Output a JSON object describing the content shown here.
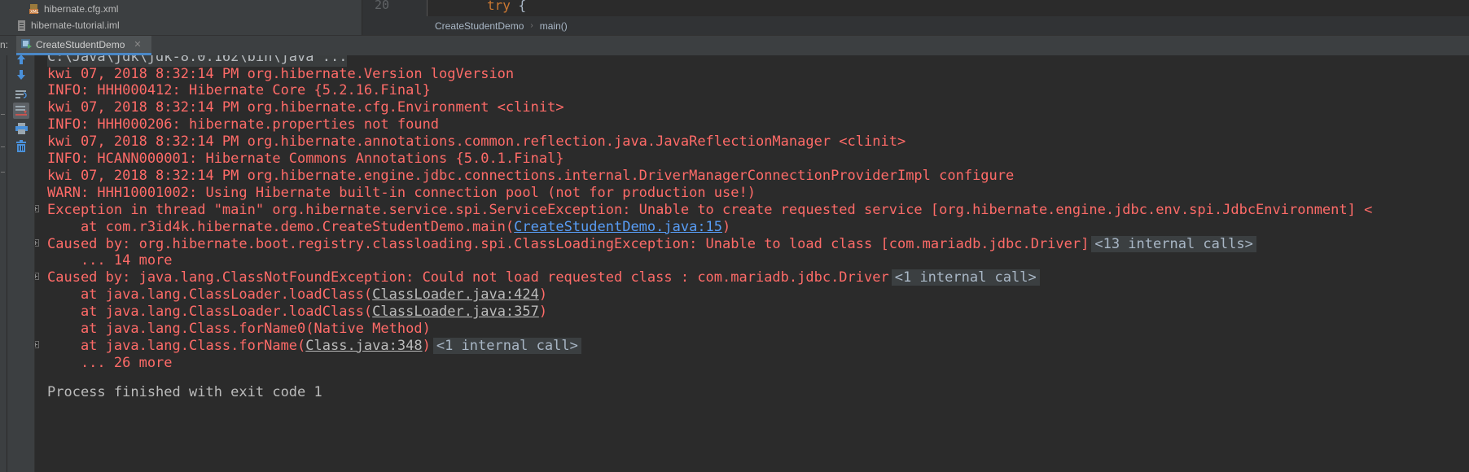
{
  "project": {
    "files": [
      {
        "name": "hibernate.cfg.xml",
        "icon": "xml-file-icon"
      },
      {
        "name": "hibernate-tutorial.iml",
        "icon": "module-file-icon"
      }
    ]
  },
  "editor": {
    "line_number": "20",
    "code_keyword": "try",
    "code_rest": " {",
    "breadcrumb": [
      "CreateStudentDemo",
      "main()"
    ]
  },
  "run_panel": {
    "label": "n:",
    "tab_title": "CreateStudentDemo",
    "toolbar_icons": [
      "up-arrow-icon",
      "down-arrow-icon",
      "soft-wrap-icon",
      "scroll-to-end-icon",
      "print-icon",
      "trash-icon"
    ]
  },
  "console": {
    "command": "C:\\Java\\jdk\\jdk-8.0.162\\bin\\java ...",
    "lines": [
      {
        "text": "kwi 07, 2018 8:32:14 PM org.hibernate.Version logVersion"
      },
      {
        "text": "INFO: HHH000412: Hibernate Core {5.2.16.Final}"
      },
      {
        "text": "kwi 07, 2018 8:32:14 PM org.hibernate.cfg.Environment <clinit>"
      },
      {
        "text": "INFO: HHH000206: hibernate.properties not found"
      },
      {
        "text": "kwi 07, 2018 8:32:14 PM org.hibernate.annotations.common.reflection.java.JavaReflectionManager <clinit>"
      },
      {
        "text": "INFO: HCANN000001: Hibernate Commons Annotations {5.0.1.Final}"
      },
      {
        "text": "kwi 07, 2018 8:32:14 PM org.hibernate.engine.jdbc.connections.internal.DriverManagerConnectionProviderImpl configure"
      },
      {
        "text": "WARN: HHH10001002: Using Hibernate built-in connection pool (not for production use!)"
      },
      {
        "text": "Exception in thread \"main\" org.hibernate.service.spi.ServiceException: Unable to create requested service [org.hibernate.engine.jdbc.env.spi.JdbcEnvironment] <",
        "fold": true
      },
      {
        "text": "    at com.r3id4k.hibernate.demo.CreateStudentDemo.main(",
        "link": "CreateStudentDemo.java:15",
        "after": ")",
        "link_style": "link"
      },
      {
        "text": "Caused by: org.hibernate.boot.registry.classloading.spi.ClassLoadingException: Unable to load class [com.mariadb.jdbc.Driver]",
        "fold": true,
        "badge": "<13 internal calls>"
      },
      {
        "text": "    ... 14 more"
      },
      {
        "text": "Caused by: java.lang.ClassNotFoundException: Could not load requested class : com.mariadb.jdbc.Driver",
        "fold": true,
        "badge": "<1 internal call>"
      },
      {
        "text": "    at java.lang.ClassLoader.loadClass(",
        "link": "ClassLoader.java:424",
        "after": ")",
        "link_style": "ulink"
      },
      {
        "text": "    at java.lang.ClassLoader.loadClass(",
        "link": "ClassLoader.java:357",
        "after": ")",
        "link_style": "ulink"
      },
      {
        "text": "    at java.lang.Class.forName0(Native Method)"
      },
      {
        "text": "    at java.lang.Class.forName(",
        "link": "Class.java:348",
        "after": ")",
        "link_style": "ulink",
        "fold": true,
        "badge": "<1 internal call>"
      },
      {
        "text": "    ... 26 more"
      }
    ],
    "exit_message": "Process finished with exit code 1"
  },
  "colors": {
    "error_text": "#ff6b68",
    "link": "#589df6",
    "background": "#2b2b2b",
    "panel": "#3c3f41"
  }
}
